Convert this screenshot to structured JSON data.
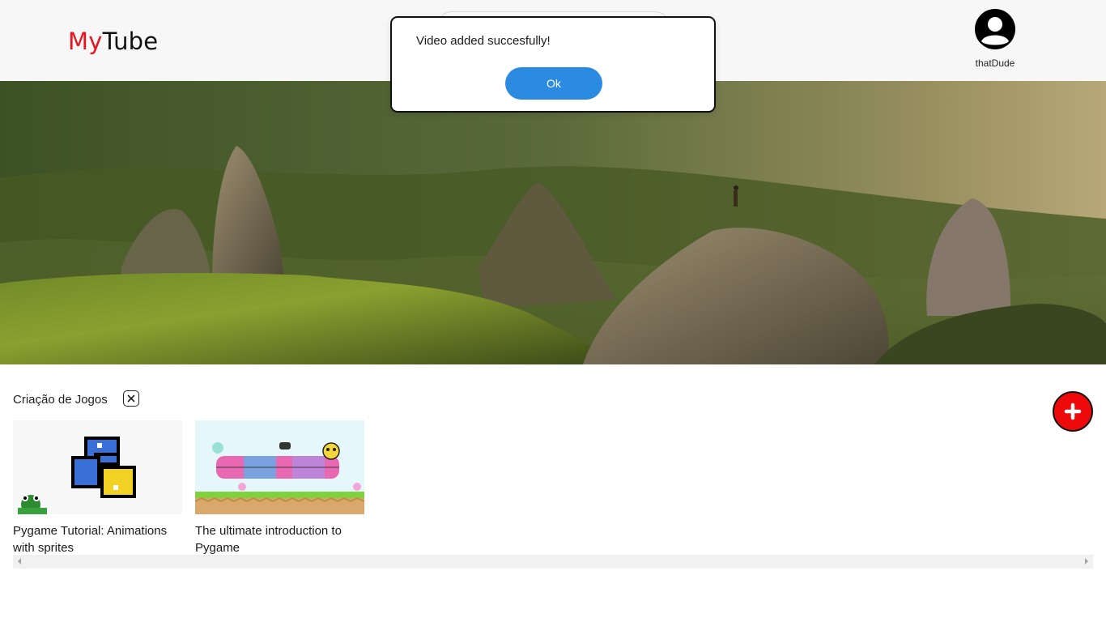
{
  "app": {
    "logo_part1": "My",
    "logo_part2": "Tube",
    "brand_color": "#e8141c"
  },
  "user": {
    "name": "thatDude",
    "avatar_icon": "user-circle-icon"
  },
  "playlist": {
    "title": "Criação de Jogos",
    "close_icon": "close-icon",
    "add_icon": "plus-icon",
    "add_color": "#ee0a0a"
  },
  "videos": [
    {
      "title": "Pygame Tutorial: Animations with sprites",
      "thumb_icon": "python-logo-thumbnail"
    },
    {
      "title": "The ultimate introduction to Pygame",
      "thumb_icon": "pygame-logo-thumbnail"
    }
  ],
  "dialog": {
    "message": "Video added succesfully!",
    "ok_label": "Ok",
    "ok_color": "#2a8be0"
  }
}
